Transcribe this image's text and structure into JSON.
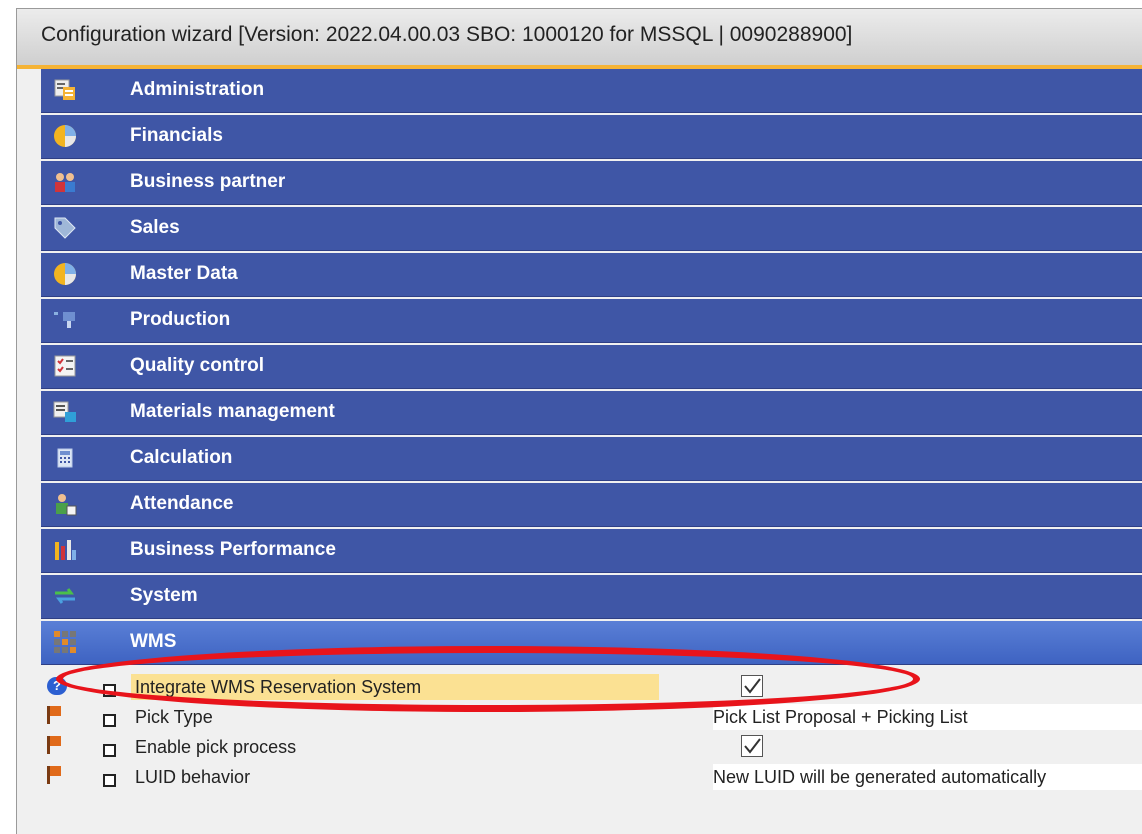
{
  "window": {
    "title": "Configuration wizard [Version: 2022.04.00.03 SBO: 1000120 for MSSQL | 0090288900]"
  },
  "modules": [
    {
      "label": "Administration",
      "icon": "document-list-icon"
    },
    {
      "label": "Financials",
      "icon": "pie-chart-icon"
    },
    {
      "label": "Business partner",
      "icon": "people-icon"
    },
    {
      "label": "Sales",
      "icon": "price-tag-icon"
    },
    {
      "label": "Master Data",
      "icon": "pie-chart-icon"
    },
    {
      "label": "Production",
      "icon": "production-icon"
    },
    {
      "label": "Quality control",
      "icon": "checklist-icon"
    },
    {
      "label": "Materials management",
      "icon": "materials-icon"
    },
    {
      "label": "Calculation",
      "icon": "calculator-icon"
    },
    {
      "label": "Attendance",
      "icon": "person-clock-icon"
    },
    {
      "label": "Business Performance",
      "icon": "bar-chart-icon"
    },
    {
      "label": "System",
      "icon": "sync-arrows-icon"
    },
    {
      "label": "WMS",
      "icon": "grid-dots-icon"
    }
  ],
  "parameters": [
    {
      "label": "Integrate WMS Reservation System",
      "value": "",
      "checked": true,
      "type": "checkbox",
      "icon": "help-icon"
    },
    {
      "label": "Pick Type",
      "value": "Pick List Proposal + Picking List",
      "type": "text",
      "icon": "flag-icon"
    },
    {
      "label": "Enable pick process",
      "value": "",
      "checked": true,
      "type": "checkbox",
      "icon": "flag-icon"
    },
    {
      "label": "LUID behavior",
      "value": "New LUID will be generated automatically",
      "type": "text",
      "icon": "flag-icon"
    }
  ],
  "colors": {
    "module_bar": "#3f56a6",
    "module_active": "#4a6fcc",
    "highlight_row": "#fbe193",
    "annotation_ellipse": "#e8141b",
    "title_accent": "#f5b335"
  }
}
